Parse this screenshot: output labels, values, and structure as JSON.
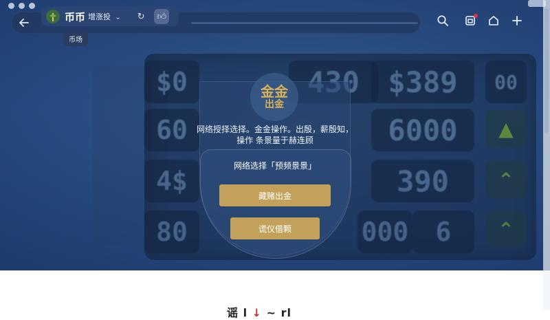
{
  "browser": {
    "site_name": "币币",
    "site_subtitle": "增涨投",
    "tooltip": "币场"
  },
  "background_board": {
    "rows": [
      {
        "left": "$0",
        "cells": [
          "430",
          "$389",
          "00"
        ]
      },
      {
        "left": "60",
        "cells": [
          "",
          "6000",
          ""
        ]
      },
      {
        "left": "4$",
        "cells": [
          "",
          "390",
          ""
        ]
      },
      {
        "left": "80",
        "cells": [
          "000",
          "6",
          ""
        ]
      }
    ]
  },
  "modal": {
    "logo_line1": "金金",
    "logo_line2": "出金",
    "description_line1": "网络授择选择。金金操作。出殷，薪殷知，",
    "description_line2": "操作 条景量于赫连顾",
    "question": "网络选择「预频景景」",
    "primary_button": "藏赌出金",
    "secondary_button": "谎仪借颗"
  },
  "footer": {
    "text_start": "谣",
    "text_mid": "l",
    "text_red": "↓",
    "text_end": " ~ rl"
  },
  "icons": {
    "back": "back-arrow-icon",
    "search": "search-icon",
    "notification": "notification-icon",
    "home": "home-icon",
    "add": "plus-icon"
  },
  "colors": {
    "accent_gold": "#c4a15a",
    "hero_blue": "#2a4e84",
    "notification_red": "#e0314a"
  }
}
